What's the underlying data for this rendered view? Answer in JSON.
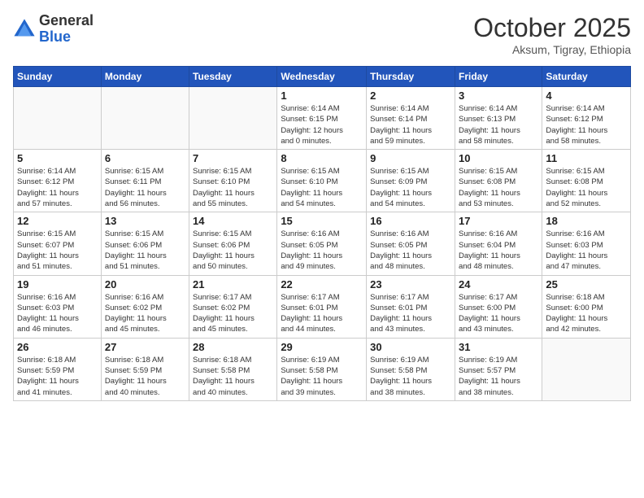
{
  "header": {
    "logo_general": "General",
    "logo_blue": "Blue",
    "month": "October 2025",
    "location": "Aksum, Tigray, Ethiopia"
  },
  "weekdays": [
    "Sunday",
    "Monday",
    "Tuesday",
    "Wednesday",
    "Thursday",
    "Friday",
    "Saturday"
  ],
  "weeks": [
    [
      {
        "day": "",
        "info": ""
      },
      {
        "day": "",
        "info": ""
      },
      {
        "day": "",
        "info": ""
      },
      {
        "day": "1",
        "info": "Sunrise: 6:14 AM\nSunset: 6:15 PM\nDaylight: 12 hours\nand 0 minutes."
      },
      {
        "day": "2",
        "info": "Sunrise: 6:14 AM\nSunset: 6:14 PM\nDaylight: 11 hours\nand 59 minutes."
      },
      {
        "day": "3",
        "info": "Sunrise: 6:14 AM\nSunset: 6:13 PM\nDaylight: 11 hours\nand 58 minutes."
      },
      {
        "day": "4",
        "info": "Sunrise: 6:14 AM\nSunset: 6:12 PM\nDaylight: 11 hours\nand 58 minutes."
      }
    ],
    [
      {
        "day": "5",
        "info": "Sunrise: 6:14 AM\nSunset: 6:12 PM\nDaylight: 11 hours\nand 57 minutes."
      },
      {
        "day": "6",
        "info": "Sunrise: 6:15 AM\nSunset: 6:11 PM\nDaylight: 11 hours\nand 56 minutes."
      },
      {
        "day": "7",
        "info": "Sunrise: 6:15 AM\nSunset: 6:10 PM\nDaylight: 11 hours\nand 55 minutes."
      },
      {
        "day": "8",
        "info": "Sunrise: 6:15 AM\nSunset: 6:10 PM\nDaylight: 11 hours\nand 54 minutes."
      },
      {
        "day": "9",
        "info": "Sunrise: 6:15 AM\nSunset: 6:09 PM\nDaylight: 11 hours\nand 54 minutes."
      },
      {
        "day": "10",
        "info": "Sunrise: 6:15 AM\nSunset: 6:08 PM\nDaylight: 11 hours\nand 53 minutes."
      },
      {
        "day": "11",
        "info": "Sunrise: 6:15 AM\nSunset: 6:08 PM\nDaylight: 11 hours\nand 52 minutes."
      }
    ],
    [
      {
        "day": "12",
        "info": "Sunrise: 6:15 AM\nSunset: 6:07 PM\nDaylight: 11 hours\nand 51 minutes."
      },
      {
        "day": "13",
        "info": "Sunrise: 6:15 AM\nSunset: 6:06 PM\nDaylight: 11 hours\nand 51 minutes."
      },
      {
        "day": "14",
        "info": "Sunrise: 6:15 AM\nSunset: 6:06 PM\nDaylight: 11 hours\nand 50 minutes."
      },
      {
        "day": "15",
        "info": "Sunrise: 6:16 AM\nSunset: 6:05 PM\nDaylight: 11 hours\nand 49 minutes."
      },
      {
        "day": "16",
        "info": "Sunrise: 6:16 AM\nSunset: 6:05 PM\nDaylight: 11 hours\nand 48 minutes."
      },
      {
        "day": "17",
        "info": "Sunrise: 6:16 AM\nSunset: 6:04 PM\nDaylight: 11 hours\nand 48 minutes."
      },
      {
        "day": "18",
        "info": "Sunrise: 6:16 AM\nSunset: 6:03 PM\nDaylight: 11 hours\nand 47 minutes."
      }
    ],
    [
      {
        "day": "19",
        "info": "Sunrise: 6:16 AM\nSunset: 6:03 PM\nDaylight: 11 hours\nand 46 minutes."
      },
      {
        "day": "20",
        "info": "Sunrise: 6:16 AM\nSunset: 6:02 PM\nDaylight: 11 hours\nand 45 minutes."
      },
      {
        "day": "21",
        "info": "Sunrise: 6:17 AM\nSunset: 6:02 PM\nDaylight: 11 hours\nand 45 minutes."
      },
      {
        "day": "22",
        "info": "Sunrise: 6:17 AM\nSunset: 6:01 PM\nDaylight: 11 hours\nand 44 minutes."
      },
      {
        "day": "23",
        "info": "Sunrise: 6:17 AM\nSunset: 6:01 PM\nDaylight: 11 hours\nand 43 minutes."
      },
      {
        "day": "24",
        "info": "Sunrise: 6:17 AM\nSunset: 6:00 PM\nDaylight: 11 hours\nand 43 minutes."
      },
      {
        "day": "25",
        "info": "Sunrise: 6:18 AM\nSunset: 6:00 PM\nDaylight: 11 hours\nand 42 minutes."
      }
    ],
    [
      {
        "day": "26",
        "info": "Sunrise: 6:18 AM\nSunset: 5:59 PM\nDaylight: 11 hours\nand 41 minutes."
      },
      {
        "day": "27",
        "info": "Sunrise: 6:18 AM\nSunset: 5:59 PM\nDaylight: 11 hours\nand 40 minutes."
      },
      {
        "day": "28",
        "info": "Sunrise: 6:18 AM\nSunset: 5:58 PM\nDaylight: 11 hours\nand 40 minutes."
      },
      {
        "day": "29",
        "info": "Sunrise: 6:19 AM\nSunset: 5:58 PM\nDaylight: 11 hours\nand 39 minutes."
      },
      {
        "day": "30",
        "info": "Sunrise: 6:19 AM\nSunset: 5:58 PM\nDaylight: 11 hours\nand 38 minutes."
      },
      {
        "day": "31",
        "info": "Sunrise: 6:19 AM\nSunset: 5:57 PM\nDaylight: 11 hours\nand 38 minutes."
      },
      {
        "day": "",
        "info": ""
      }
    ]
  ]
}
